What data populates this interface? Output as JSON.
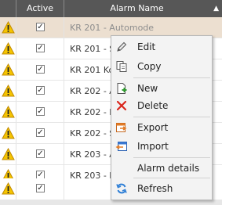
{
  "header": {
    "active_label": "Active",
    "name_label": "Alarm Name"
  },
  "rows": [
    {
      "name": "KR 201 - Automode",
      "active": true,
      "selected": true
    },
    {
      "name": "KR 201 - S",
      "active": true
    },
    {
      "name": "KR 201 Ko",
      "active": true
    },
    {
      "name": "KR 202 - A",
      "active": true
    },
    {
      "name": "KR 202 - F",
      "active": true
    },
    {
      "name": "KR 202 - S",
      "active": true
    },
    {
      "name": "KR 203 - A",
      "active": true
    },
    {
      "name": "KR 203 - F",
      "active": true
    },
    {
      "name": "",
      "active": true
    }
  ],
  "context_menu": {
    "items": [
      {
        "label": "Edit",
        "icon": "pencil-icon"
      },
      {
        "label": "Copy",
        "icon": "copy-icon"
      },
      {
        "label": "New",
        "icon": "new-document-icon"
      },
      {
        "label": "Delete",
        "icon": "delete-x-icon"
      },
      {
        "label": "Export",
        "icon": "export-icon"
      },
      {
        "label": "Import",
        "icon": "import-icon"
      },
      {
        "label": "Alarm details",
        "icon": ""
      },
      {
        "label": "Refresh",
        "icon": "refresh-icon"
      }
    ]
  },
  "colors": {
    "header_bg": "#575757",
    "selected_row": "#ecdfd0",
    "warning_yellow": "#f5c400",
    "delete_red": "#d9261c",
    "refresh_blue": "#2f7fd6"
  }
}
